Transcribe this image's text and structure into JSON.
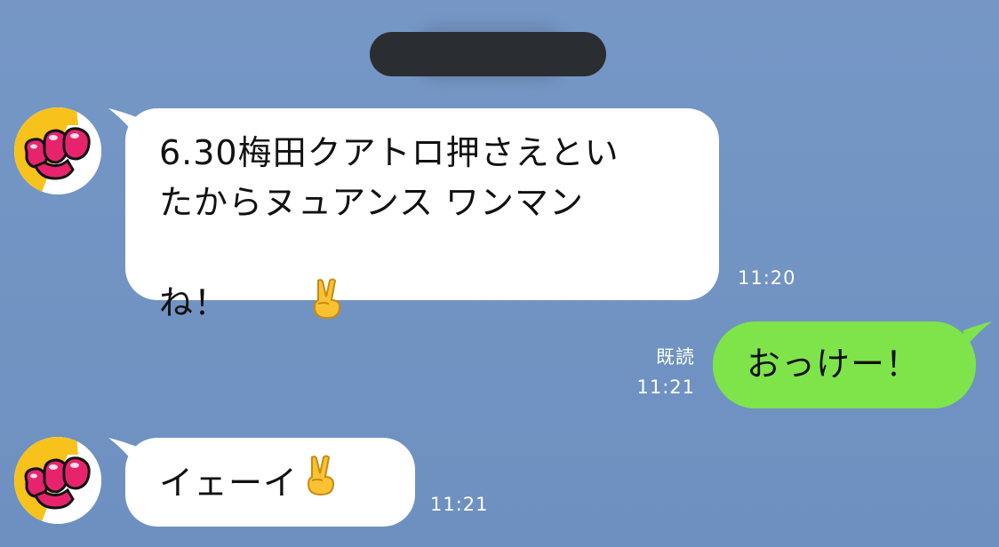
{
  "header": {
    "contact_name_redacted": true
  },
  "messages": [
    {
      "direction": "incoming",
      "sender_avatar_icon": "fist-avatar-icon",
      "lines": [
        "6.30梅田クアトロ押さえとい",
        "たからヌュアンス ワンマン",
        "ね！"
      ],
      "emoji_icon": "victory-hand-emoji-icon",
      "time": "11:20"
    },
    {
      "direction": "outgoing",
      "text": "おっけー！",
      "read_label": "既読",
      "time": "11:21"
    },
    {
      "direction": "incoming",
      "sender_avatar_icon": "fist-avatar-icon",
      "text": "イェーイ",
      "emoji_icon": "victory-hand-emoji-icon",
      "time": "11:21"
    }
  ],
  "colors": {
    "background": "#7093c4",
    "incoming_bubble": "#ffffff",
    "outgoing_bubble": "#7ee44a",
    "redaction": "#2a2d31",
    "avatar_accent_yellow": "#f7c21b",
    "avatar_accent_pink": "#e8236e"
  }
}
